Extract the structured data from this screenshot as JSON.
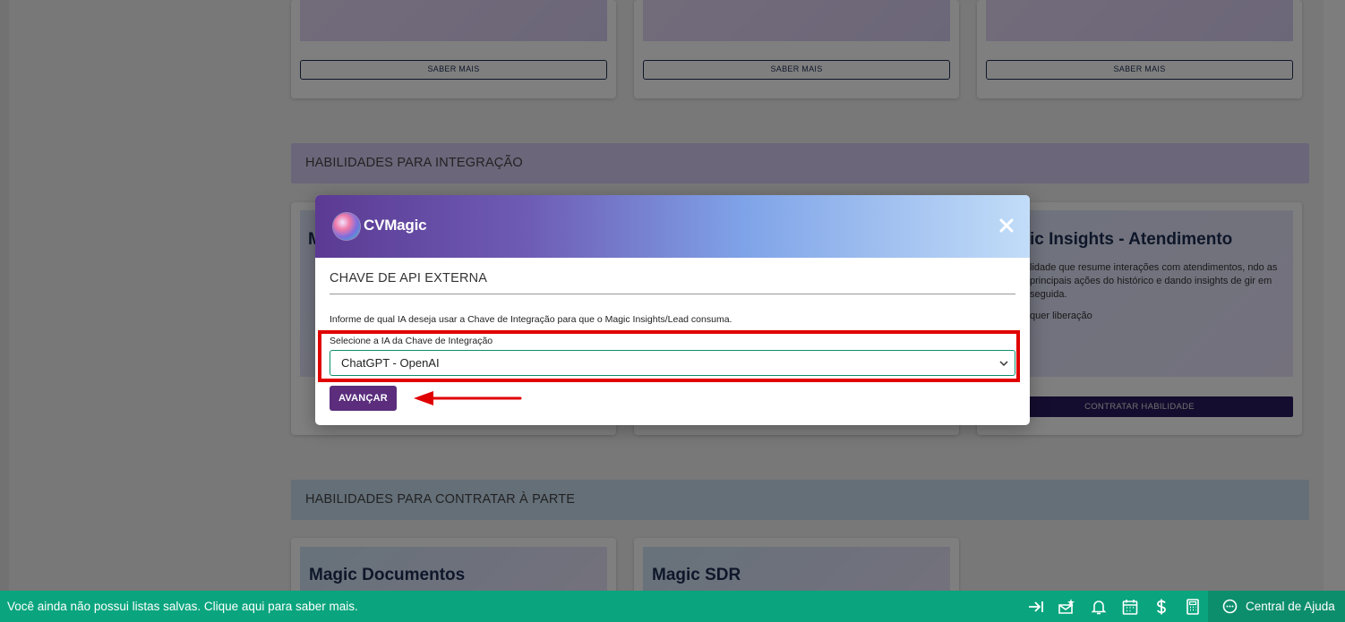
{
  "background": {
    "top_cards": [
      {
        "button_label": "SABER MAIS"
      },
      {
        "button_label": "SABER MAIS"
      },
      {
        "button_label": "SABER MAIS"
      }
    ],
    "section_integration": "HABILIDADES PARA INTEGRAÇÃO",
    "integration_card_partial_letter": "M",
    "insights_card": {
      "title": "ic Insights - Atendimento",
      "description": "lidade que resume interações com atendimentos, ndo as principais ações do histórico e dando insights de gir em seguida.",
      "status": "quer liberação",
      "button_label": "CONTRATAR HABILIDADE"
    },
    "section_parte": "HABILIDADES PARA CONTRATAR À PARTE",
    "bottom_cards": [
      {
        "title": "Magic Documentos"
      },
      {
        "title": "Magic SDR"
      }
    ]
  },
  "modal": {
    "brand": "CVMagic",
    "close_icon": "close-icon",
    "title": "CHAVE DE API EXTERNA",
    "info": "Informe de qual IA deseja usar a Chave de Integração para que o Magic Insights/Lead consuma.",
    "select_label": "Selecione a IA da Chave de Integração",
    "select_value": "ChatGPT - OpenAI",
    "submit_label": "AVANÇAR",
    "highlight_color": "#e00000",
    "arrow_color": "#e00000"
  },
  "footer": {
    "message": "Você ainda não possui listas salvas. Clique aqui para saber mais.",
    "icons": [
      "arrow-to-right-icon",
      "mailbox-star-icon",
      "bell-icon",
      "calendar-icon",
      "dollar-icon",
      "calculator-icon"
    ],
    "help_label": "Central de Ajuda",
    "color": "#0aa57e"
  }
}
